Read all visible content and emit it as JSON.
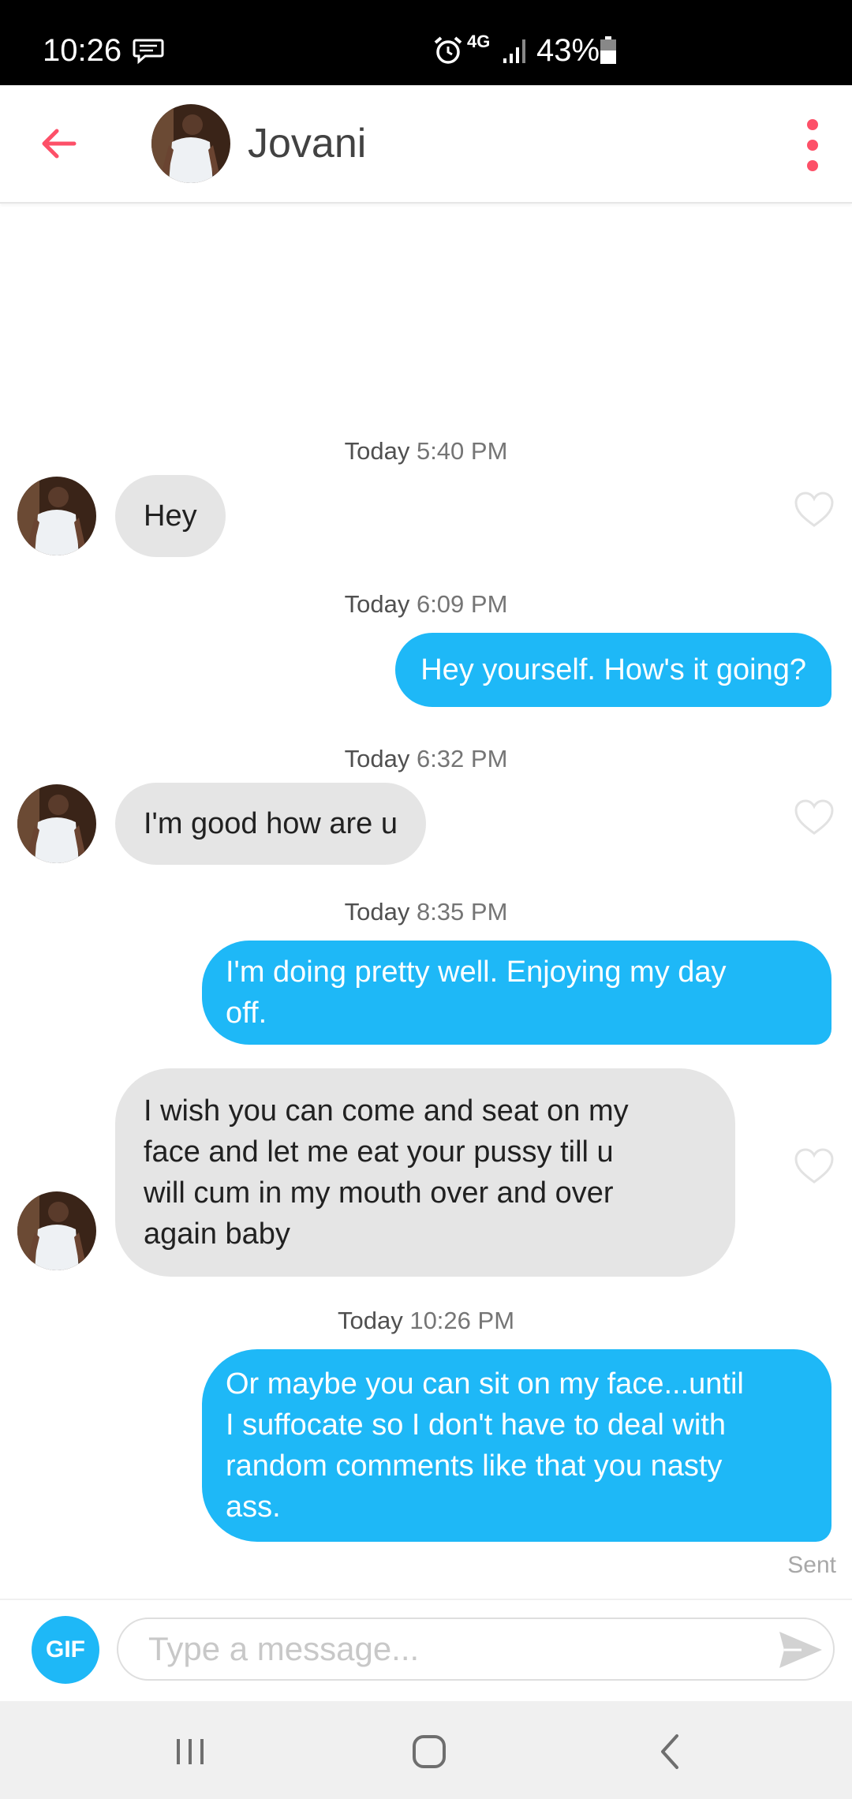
{
  "status_bar": {
    "time": "10:26",
    "network": "4G",
    "battery": "43%"
  },
  "header": {
    "contact_name": "Jovani",
    "back_icon": "arrow-left-icon",
    "menu_icon": "more-vertical-icon",
    "accent_color": "#fd5068"
  },
  "messages": [
    {
      "timestamp": {
        "day": "Today",
        "time": "5:40 PM"
      },
      "direction": "in",
      "text": "Hey"
    },
    {
      "timestamp": {
        "day": "Today",
        "time": "6:09 PM"
      },
      "direction": "out",
      "text": "Hey yourself. How's it going?"
    },
    {
      "timestamp": {
        "day": "Today",
        "time": "6:32 PM"
      },
      "direction": "in",
      "text": "I'm good how are u"
    },
    {
      "timestamp": {
        "day": "Today",
        "time": "8:35 PM"
      },
      "direction": "out",
      "lines": [
        "I'm doing pretty well. Enjoying my day",
        "off."
      ]
    },
    {
      "direction": "in",
      "lines": [
        "I wish you can come and seat on my",
        "face and let me eat your pussy till u",
        "will cum in my mouth over and over",
        "again baby"
      ]
    },
    {
      "timestamp": {
        "day": "Today",
        "time": "10:26 PM"
      },
      "direction": "out",
      "lines": [
        "Or maybe you can sit on my face...until",
        "I suffocate so I don't have to deal with",
        "random comments like that you nasty",
        "ass."
      ]
    }
  ],
  "sent_status": "Sent",
  "composer": {
    "gif_label": "GIF",
    "placeholder": "Type a message..."
  },
  "colors": {
    "outgoing_bubble": "#1eb8f7",
    "incoming_bubble": "#e5e5e5"
  }
}
